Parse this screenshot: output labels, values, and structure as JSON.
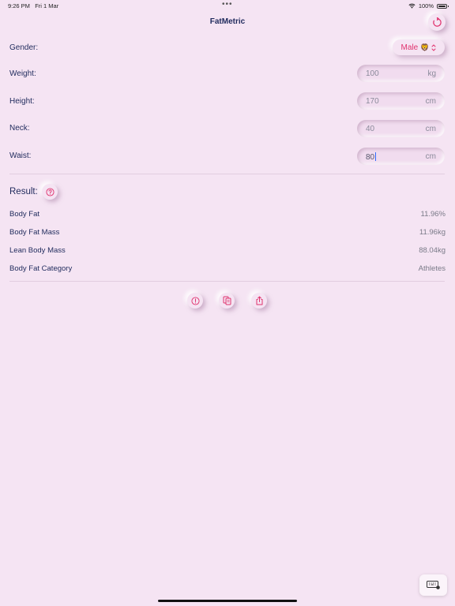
{
  "status_bar": {
    "time": "9:26 PM",
    "date": "Fri 1 Mar",
    "battery": "100%"
  },
  "header": {
    "title": "FatMetric"
  },
  "form": {
    "gender": {
      "label": "Gender:",
      "value": "Male",
      "emoji": "🦁"
    },
    "weight": {
      "label": "Weight:",
      "value": "100",
      "unit": "kg"
    },
    "height": {
      "label": "Height:",
      "value": "170",
      "unit": "cm"
    },
    "neck": {
      "label": "Neck:",
      "value": "40",
      "unit": "cm"
    },
    "waist": {
      "label": "Waist:",
      "value": "80",
      "unit": "cm"
    }
  },
  "result": {
    "label": "Result:",
    "rows": [
      {
        "label": "Body Fat",
        "value": "11.96%"
      },
      {
        "label": "Body Fat Mass",
        "value": "11.96kg"
      },
      {
        "label": "Lean Body Mass",
        "value": "88.04kg"
      },
      {
        "label": "Body Fat Category",
        "value": "Athletes"
      }
    ]
  },
  "colors": {
    "background": "#f5e4f3",
    "accent": "#e0336e",
    "text": "#1f2a5c"
  }
}
